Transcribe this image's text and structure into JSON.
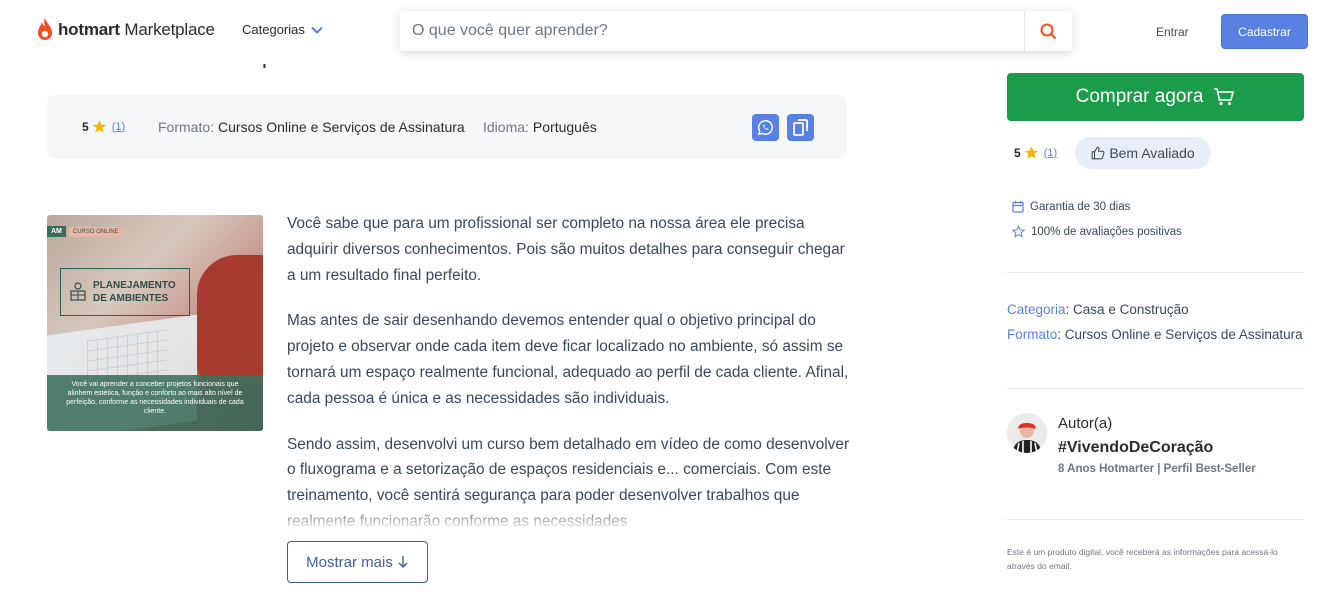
{
  "header": {
    "logo_bold": "hotmart",
    "logo_regular": " Marketplace",
    "categorias": "Categorias",
    "search_placeholder": "O que você quer aprender?",
    "entrar": "Entrar",
    "cadastrar": "Cadastrar"
  },
  "title_remnant": "j",
  "info": {
    "rating": "5",
    "rating_count": "(1)",
    "formato_label": "Formato:",
    "formato_value": "Cursos Online e Serviços de Assinatura",
    "idioma_label": "Idioma:",
    "idioma_value": "Português"
  },
  "thumbnail": {
    "tag_am": "AM",
    "tag_type": "CURSO ONLINE",
    "title": "PLANEJAMENTO\nDE AMBIENTES",
    "caption": "Você vai aprender a conceber projetos funcionais que alinhem estética, função e conforto ao mais alto nível de perfeição, conforme as necessidades individuais de cada cliente."
  },
  "description": {
    "p1": "Você sabe que para um profissional ser completo na nossa área ele precisa adquirir diversos conhecimentos. Pois são muitos detalhes para conseguir chegar a um resultado final perfeito.",
    "p2": "Mas antes de sair desenhando devemos entender qual o objetivo principal do projeto e observar onde cada item deve ficar localizado no ambiente, só assim se tornará um espaço realmente funcional, adequado ao perfil de cada cliente. Afinal, cada pessoa é única e as necessidades são individuais.",
    "p3": "Sendo assim, desenvolvi um curso bem detalhado em vídeo de como desenvolver o fluxograma e a setorização de espaços residenciais e... comerciais. Com este treinamento, você sentirá segurança para poder desenvolver trabalhos que realmente funcionarão conforme as necessidades",
    "show_more": "Mostrar mais"
  },
  "sidebar": {
    "buy_label": "Comprar agora",
    "rating": "5",
    "rating_count": "(1)",
    "badge": "Bem Avaliado",
    "guarantee": "Garantia de 30 dias",
    "positive": "100% de avaliações positivas",
    "categoria_label": "Categoria",
    "categoria_value": ": Casa e Construção",
    "formato_label": "Formato",
    "formato_value": ": Cursos Online e Serviços de Assinatura",
    "author_label": "Autor(a)",
    "author_name": "#VivendoDeCoração",
    "author_sub": "8 Anos Hotmarter | Perfil Best-Seller",
    "footnote": "Este é um produto digital, você receberá as informações para acessá-lo através do email."
  },
  "colors": {
    "accent_blue": "#5981e3",
    "buy_green": "#1a9c4a",
    "hotmart_orange": "#f04e23",
    "star_yellow": "#f2b705"
  },
  "icons": [
    "hotmart-flame-icon",
    "chevron-down-icon",
    "search-icon",
    "star-icon",
    "whatsapp-icon",
    "copy-icon",
    "cart-icon",
    "thumbs-up-icon",
    "calendar-icon",
    "star-outline-icon",
    "arrow-down-icon"
  ]
}
